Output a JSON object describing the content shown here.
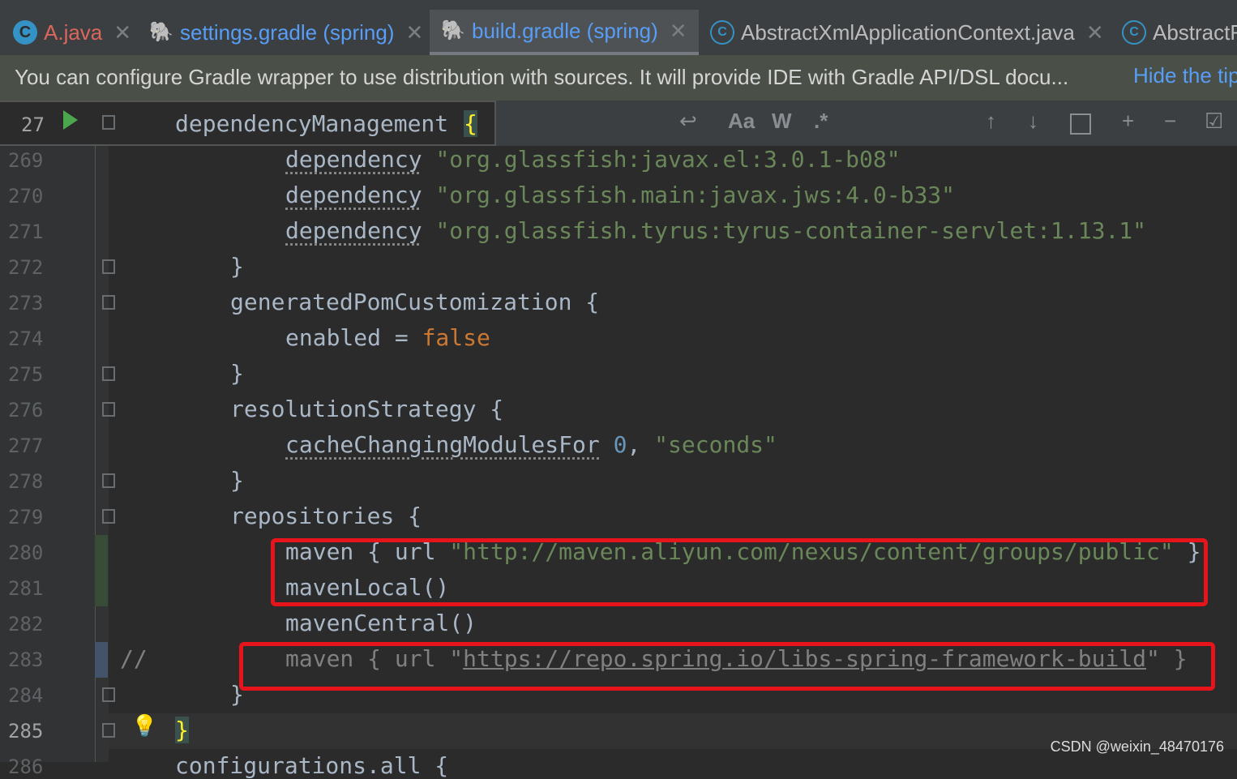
{
  "tabs": [
    {
      "label": "A.java",
      "icon": "java-class-icon",
      "color": "#d9675b"
    },
    {
      "label": "settings.gradle (spring)",
      "icon": "gradle-elephant-icon",
      "color": "#589df6"
    },
    {
      "label": "build.gradle (spring)",
      "icon": "gradle-elephant-icon",
      "color": "#589df6"
    },
    {
      "label": "AbstractXmlApplicationContext.java",
      "icon": "class-icon",
      "color": "#bbbbbb"
    },
    {
      "label": "AbstractR",
      "icon": "class-icon",
      "color": "#bbbbbb"
    }
  ],
  "banner": {
    "message": "You can configure Gradle wrapper to use distribution with sources. It will provide IDE with Gradle API/DSL docu...",
    "action": "Hide the tip"
  },
  "sticky": {
    "line": "27",
    "text": "dependencyManagement",
    "brace": "{"
  },
  "toolbar": {
    "aa": "Aa",
    "w": "W",
    "regex": ".*",
    "up": "↑",
    "down": "↓"
  },
  "lines": [
    {
      "n": "269"
    },
    {
      "n": "270"
    },
    {
      "n": "271"
    },
    {
      "n": "272"
    },
    {
      "n": "273"
    },
    {
      "n": "274"
    },
    {
      "n": "275"
    },
    {
      "n": "276"
    },
    {
      "n": "277"
    },
    {
      "n": "278"
    },
    {
      "n": "279"
    },
    {
      "n": "280"
    },
    {
      "n": "281"
    },
    {
      "n": "282"
    },
    {
      "n": "283"
    },
    {
      "n": "284"
    },
    {
      "n": "285"
    },
    {
      "n": "286"
    }
  ],
  "code": {
    "l269_kw": "dependency",
    "l269_str": "\"org.glassfish:javax.el:3.0.1-b08\"",
    "l270_kw": "dependency",
    "l270_str": "\"org.glassfish.main:javax.jws:4.0-b33\"",
    "l271_kw": "dependency",
    "l271_str": "\"org.glassfish.tyrus:tyrus-container-servlet:1.13.1\"",
    "l272": "}",
    "l273": "generatedPomCustomization {",
    "l274_a": "enabled = ",
    "l274_b": "false",
    "l275": "}",
    "l276": "resolutionStrategy {",
    "l277_a": "cacheChangingModulesFor",
    "l277_b": "0",
    ", ": ", ",
    "l277_c": "\"seconds\"",
    "l278": "}",
    "l279": "repositories {",
    "l280_a": "maven { url ",
    "l280_b": "\"http://maven.aliyun.com/nexus/content/groups/public\"",
    "l280_c": " }",
    "l281": "mavenLocal()",
    "l282": "mavenCentral()",
    "l283_cmt": "//",
    "l283_a": "maven { url \"",
    "l283_b": "https://repo.spring.io/libs-spring-framework-build",
    "l283_c": "\" }",
    "l284": "}",
    "l285": "}",
    "l286": "configurations.all {"
  },
  "watermark": "CSDN @weixin_48470176"
}
